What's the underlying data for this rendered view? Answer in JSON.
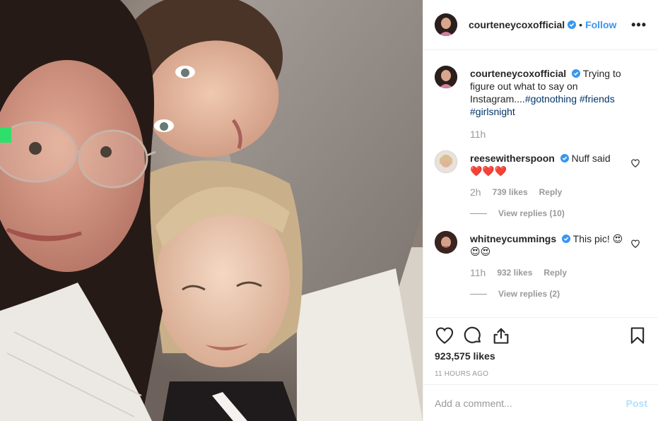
{
  "post": {
    "author": "courteneycoxofficial",
    "separator": "•",
    "follow_label": "Follow",
    "more_label": "•••",
    "caption": {
      "user": "courteneycoxofficial",
      "text": "Trying to figure out what to say on Instagram....",
      "tags": [
        "#gotnothing",
        "#friends",
        "#girlsnight"
      ],
      "time": "11h"
    },
    "comments": [
      {
        "user": "reesewitherspoon",
        "text": "Nuff said",
        "emoji": "❤️❤️❤️",
        "time": "2h",
        "likes": "739 likes",
        "reply_label": "Reply",
        "view_replies": "View replies (10)"
      },
      {
        "user": "whitneycummings",
        "text": "This pic! 😍",
        "emoji": "😍😍",
        "time": "11h",
        "likes": "932 likes",
        "reply_label": "Reply",
        "view_replies": "View replies (2)"
      }
    ],
    "likes_count": "923,575 likes",
    "posted_ago": "11 HOURS AGO",
    "add_comment_placeholder": "Add a comment...",
    "post_label": "Post"
  },
  "icons": {
    "like": "heart-icon",
    "comment": "comment-icon",
    "share": "share-icon",
    "save": "bookmark-icon",
    "verified": "verified-badge-icon"
  },
  "colors": {
    "link": "#3897f0",
    "hashtag": "#003569",
    "muted": "#999999",
    "post_disabled": "#b2dffc"
  }
}
